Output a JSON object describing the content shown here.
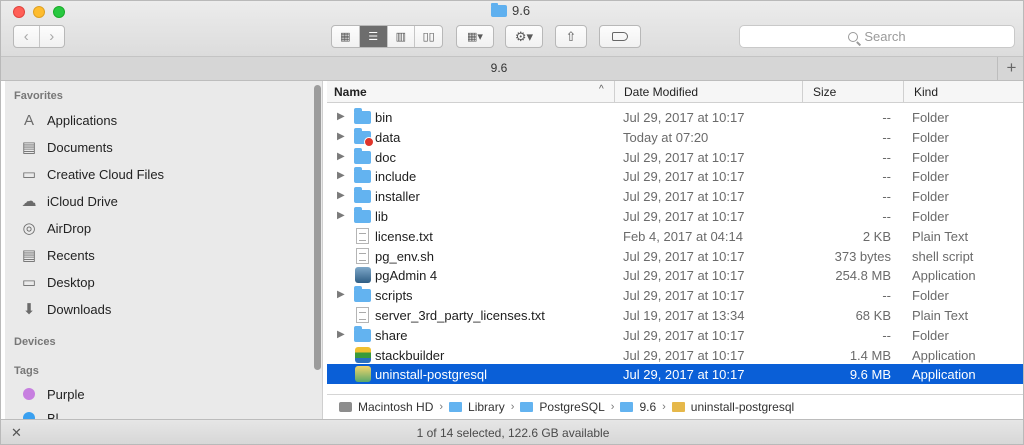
{
  "window": {
    "title": "9.6"
  },
  "toolbar": {
    "back_icon": "chevron-left",
    "forward_icon": "chevron-right",
    "view_icons": [
      "icon-view",
      "list-view",
      "column-view",
      "cover-flow-view"
    ],
    "arrange_label": "▦▾",
    "action_label": "⚙▾",
    "share_label": "⇧",
    "search_placeholder": "Search"
  },
  "tab": {
    "title": "9.6",
    "add_label": "+"
  },
  "sidebar": {
    "favorites_header": "Favorites",
    "favorites": [
      {
        "label": "Applications",
        "icon": "applications-icon",
        "glyph": "A"
      },
      {
        "label": "Documents",
        "icon": "documents-icon",
        "glyph": "▤"
      },
      {
        "label": "Creative Cloud Files",
        "icon": "folder-icon",
        "glyph": "▭"
      },
      {
        "label": "iCloud Drive",
        "icon": "cloud-icon",
        "glyph": "☁"
      },
      {
        "label": "AirDrop",
        "icon": "airdrop-icon",
        "glyph": "◎"
      },
      {
        "label": "Recents",
        "icon": "recents-icon",
        "glyph": "▤"
      },
      {
        "label": "Desktop",
        "icon": "desktop-icon",
        "glyph": "▭"
      },
      {
        "label": "Downloads",
        "icon": "downloads-icon",
        "glyph": "⬇"
      }
    ],
    "devices_header": "Devices",
    "tags_header": "Tags",
    "tags": [
      {
        "label": "Purple",
        "color": "#c77fe0"
      },
      {
        "label": "Bl",
        "color": "#3aa0f0"
      }
    ]
  },
  "columns": {
    "name": "Name",
    "date": "Date Modified",
    "size": "Size",
    "kind": "Kind"
  },
  "files": [
    {
      "name": "bin",
      "date": "Jul 29, 2017 at 10:17",
      "size": "--",
      "kind": "Folder",
      "icon": "folder"
    },
    {
      "name": "data",
      "date": "Today at 07:20",
      "size": "--",
      "kind": "Folder",
      "icon": "folder-locked"
    },
    {
      "name": "doc",
      "date": "Jul 29, 2017 at 10:17",
      "size": "--",
      "kind": "Folder",
      "icon": "folder"
    },
    {
      "name": "include",
      "date": "Jul 29, 2017 at 10:17",
      "size": "--",
      "kind": "Folder",
      "icon": "folder"
    },
    {
      "name": "installer",
      "date": "Jul 29, 2017 at 10:17",
      "size": "--",
      "kind": "Folder",
      "icon": "folder"
    },
    {
      "name": "lib",
      "date": "Jul 29, 2017 at 10:17",
      "size": "--",
      "kind": "Folder",
      "icon": "folder"
    },
    {
      "name": "license.txt",
      "date": "Feb 4, 2017 at 04:14",
      "size": "2 KB",
      "kind": "Plain Text",
      "icon": "doc"
    },
    {
      "name": "pg_env.sh",
      "date": "Jul 29, 2017 at 10:17",
      "size": "373 bytes",
      "kind": "shell script",
      "icon": "doc"
    },
    {
      "name": "pgAdmin 4",
      "date": "Jul 29, 2017 at 10:17",
      "size": "254.8 MB",
      "kind": "Application",
      "icon": "app-elephant"
    },
    {
      "name": "scripts",
      "date": "Jul 29, 2017 at 10:17",
      "size": "--",
      "kind": "Folder",
      "icon": "folder"
    },
    {
      "name": "server_3rd_party_licenses.txt",
      "date": "Jul 19, 2017 at 13:34",
      "size": "68 KB",
      "kind": "Plain Text",
      "icon": "doc"
    },
    {
      "name": "share",
      "date": "Jul 29, 2017 at 10:17",
      "size": "--",
      "kind": "Folder",
      "icon": "folder"
    },
    {
      "name": "stackbuilder",
      "date": "Jul 29, 2017 at 10:17",
      "size": "1.4 MB",
      "kind": "Application",
      "icon": "app-stack"
    },
    {
      "name": "uninstall-postgresql",
      "date": "Jul 29, 2017 at 10:17",
      "size": "9.6 MB",
      "kind": "Application",
      "icon": "app-uninstall",
      "selected": true
    }
  ],
  "pathbar": [
    "Macintosh HD",
    "Library",
    "PostgreSQL",
    "9.6",
    "uninstall-postgresql"
  ],
  "status": {
    "text": "1 of 14 selected, 122.6 GB available"
  },
  "colors": {
    "selection": "#0a5fd7",
    "folder": "#63b3f0"
  }
}
